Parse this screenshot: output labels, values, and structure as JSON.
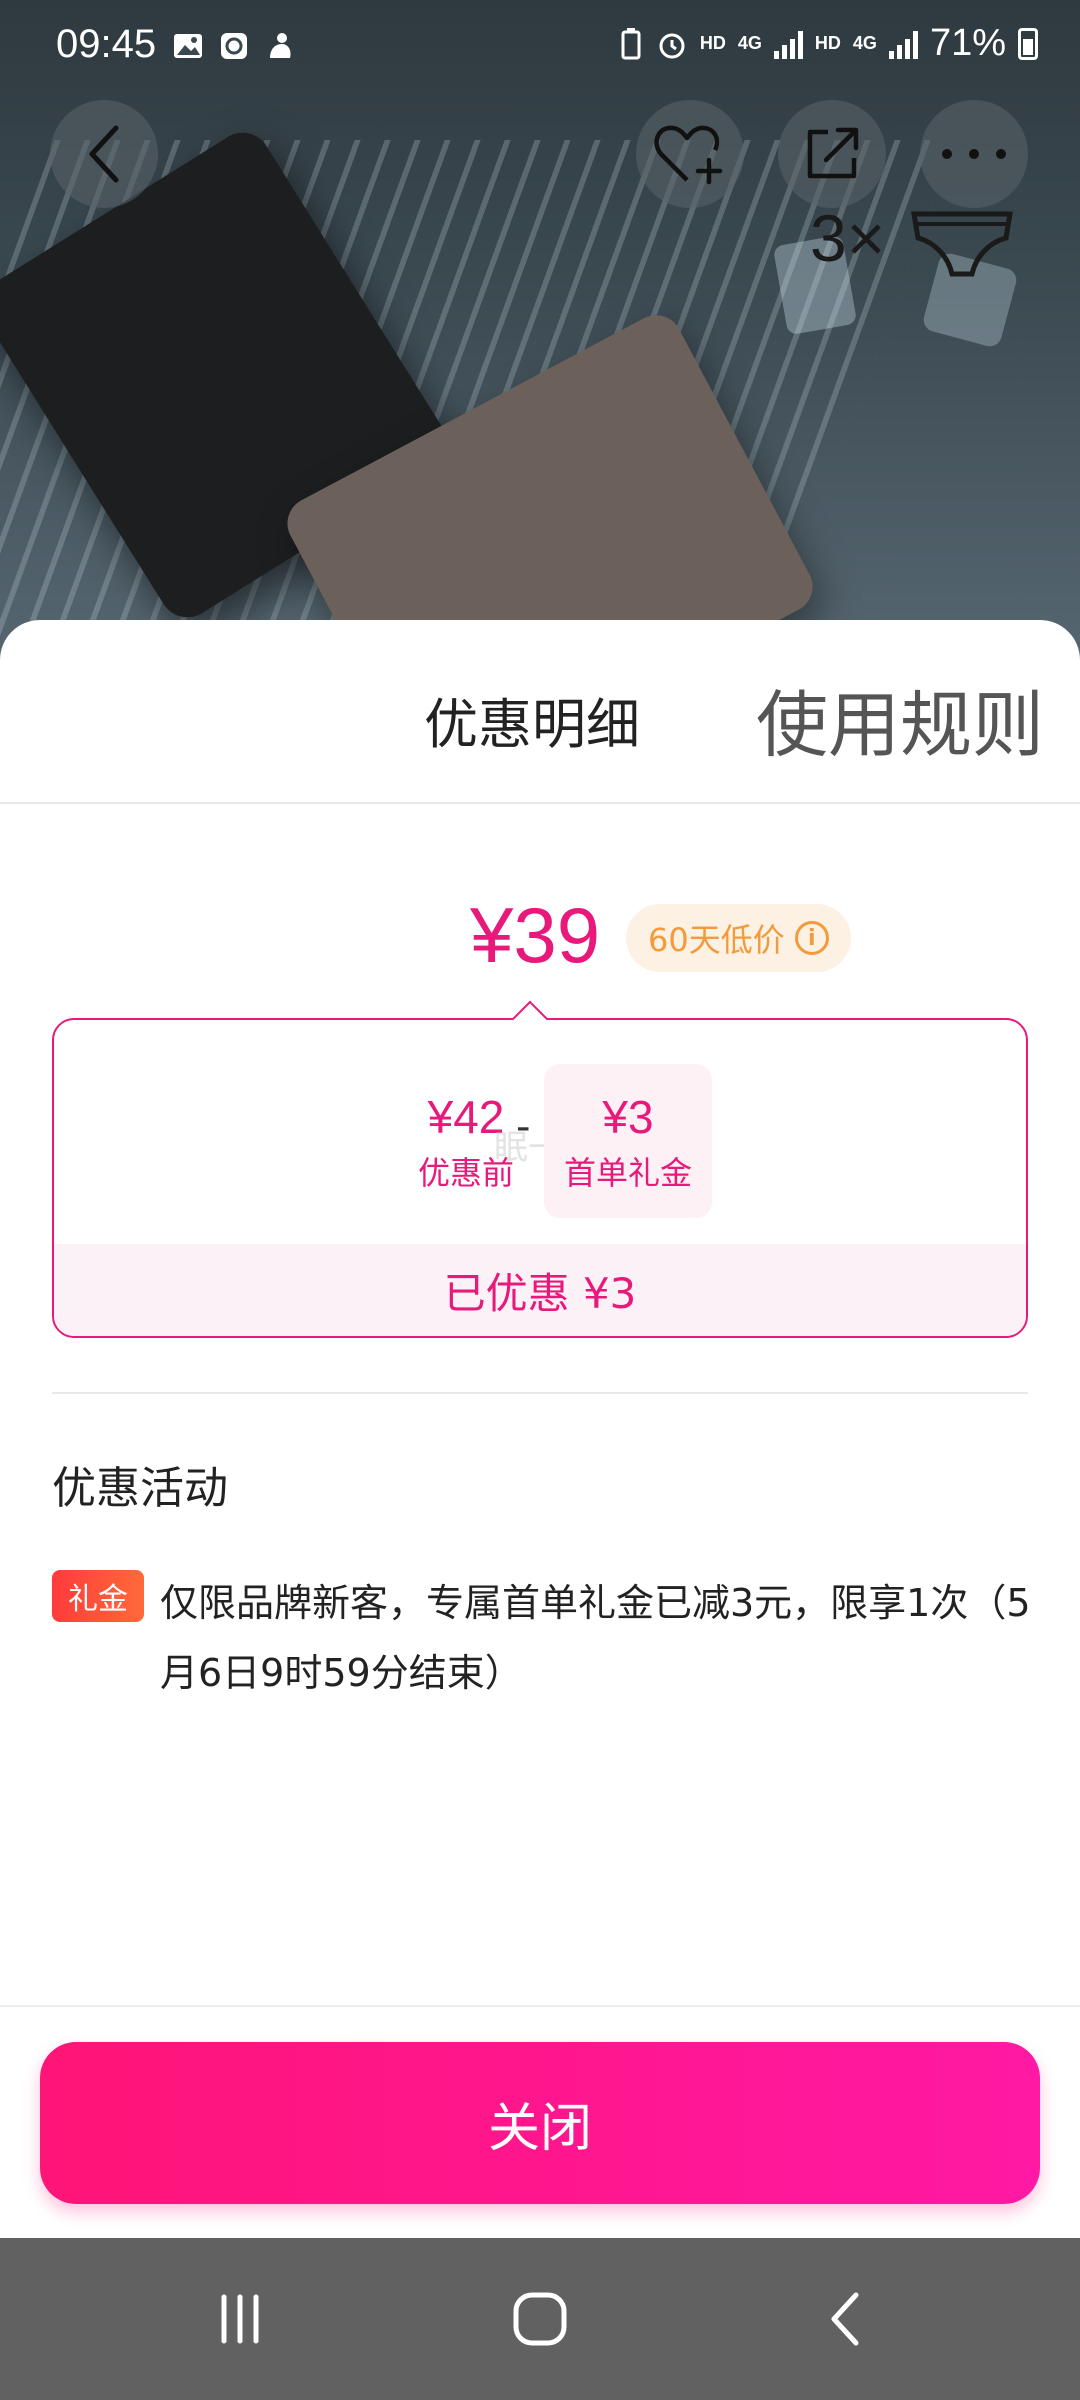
{
  "status_bar": {
    "time": "09:45",
    "hd1": "HD",
    "net1": "4G",
    "hd2": "HD",
    "net2": "4G",
    "battery": "71%"
  },
  "hero": {
    "pack_count": "3×"
  },
  "sheet": {
    "tab_details": "优惠明细",
    "tab_rules": "使用规则",
    "price": "¥39",
    "low_price_tag": "60天低价",
    "info_icon_glyph": "i",
    "before": {
      "value": "¥42",
      "label": "优惠前"
    },
    "minus": "-",
    "watermark": "眠一眠",
    "gift": {
      "value": "¥3",
      "label": "首单礼金"
    },
    "saved": "已优惠 ¥3",
    "section_title": "优惠活动",
    "activity": {
      "badge": "礼金",
      "text": "仅限品牌新客，专属首单礼金已减3元，限享1次（5月6日9时59分结束）"
    },
    "close_button": "关闭"
  },
  "colors": {
    "accent": "#e8197a",
    "button_start": "#ff1477",
    "button_end": "#ff19a4",
    "low_tag_text": "#f39a3a",
    "gift_badge": "#ff3b3b"
  }
}
